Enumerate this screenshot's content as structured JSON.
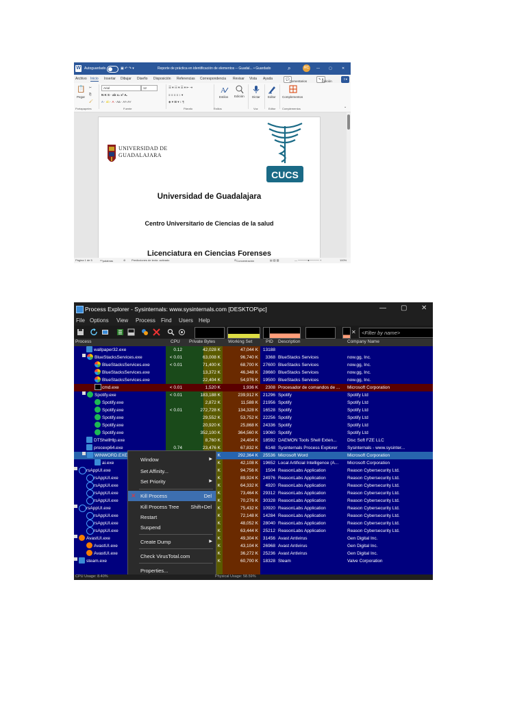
{
  "word": {
    "title": "Reporte de práctica en identificación de elementos -- Guadal... • Guardado",
    "autosave": "Autoguardado",
    "avatar": "RC",
    "menu": [
      "Archivo",
      "Inicio",
      "Insertar",
      "Dibujar",
      "Diseño",
      "Disposición",
      "Referencias",
      "Correspondencia",
      "Revisar",
      "Vista",
      "Ayuda"
    ],
    "comments_btn": "Comentarios",
    "editing_btn": "Edición",
    "font_name": "Arial",
    "font_size": "12",
    "ribbon": {
      "paste": "Pegar",
      "clipboard": "Portapapeles",
      "font_group": "Fuente",
      "paragraph": "Párrafo",
      "styles": "Estilos",
      "styles_group": "Estilos",
      "find": "Edición",
      "dictate": "Dictar",
      "voice": "Voz",
      "editor": "Editor",
      "editor_group": "Editor",
      "addins": "Complementos",
      "addins_group": "Complementos"
    },
    "doc": {
      "udg_logo_text_1": "Universidad de",
      "udg_logo_text_2": "Guadalajara",
      "cucs_label": "CUCS",
      "heading": "Universidad de Guadalajara",
      "subheading": "Centro Universitario de Ciencias de la salud",
      "partial_heading": "Licenciatura en Ciencias Forenses"
    },
    "status": {
      "page": "Página 1 de 5",
      "words": "palabras",
      "predictions": "Predicciones de texto: activado",
      "focus": "Concentración",
      "zoom": "100%"
    }
  },
  "procexp": {
    "title": "Process Explorer - Sysinternals: www.sysinternals.com [DESKTOP\\pc]",
    "menu": [
      "File",
      "Options",
      "View",
      "Process",
      "Find",
      "Users",
      "Help"
    ],
    "filter_placeholder": "<Filter by name>",
    "headers": {
      "process": "Process",
      "cpu": "CPU",
      "private": "Private Bytes",
      "working": "Working Set",
      "pid": "PID",
      "desc": "Description",
      "company": "Company Name"
    },
    "rows": [
      {
        "name": "wallpaper32.exe",
        "ind": 18,
        "icon": "sq",
        "cpu": "0.12",
        "pb": "42,028 K",
        "ws": "47,044 K",
        "pid": "13188",
        "desc": "",
        "co": ""
      },
      {
        "name": "BlueStacksServices.exe",
        "ind": 12,
        "icon": "bs",
        "tree": true,
        "cpu": "< 0.01",
        "pb": "63,008 K",
        "ws": "96,740 K",
        "pid": "3368",
        "desc": "BlueStacks Services",
        "co": "now.gg, Inc."
      },
      {
        "name": "BlueStacksServices.exe",
        "ind": 30,
        "icon": "bs",
        "cpu": "< 0.01",
        "pb": "71,400 K",
        "ws": "68,700 K",
        "pid": "27600",
        "desc": "BlueStacks Services",
        "co": "now.gg, Inc."
      },
      {
        "name": "BlueStacksServices.exe",
        "ind": 30,
        "icon": "bs",
        "cpu": "",
        "pb": "13,372 K",
        "ws": "46,348 K",
        "pid": "28660",
        "desc": "BlueStacks Services",
        "co": "now.gg, Inc."
      },
      {
        "name": "BlueStacksServices.exe",
        "ind": 30,
        "icon": "bs",
        "cpu": "",
        "pb": "22,404 K",
        "ws": "54,976 K",
        "pid": "19500",
        "desc": "BlueStacks Services",
        "co": "now.gg, Inc."
      },
      {
        "name": "cmd.exe",
        "ind": 30,
        "icon": "cm",
        "cpu": "< 0.01",
        "pb": "1,520 K",
        "ws": "1,936 K",
        "pid": "2308",
        "desc": "Procesador de comandos de ...",
        "co": "Microsoft Corporation",
        "cls": "cmd"
      },
      {
        "name": "Spotify.exe",
        "ind": 12,
        "icon": "sp",
        "tree": true,
        "cpu": "< 0.01",
        "pb": "183,188 K",
        "ws": "239,912 K",
        "pid": "21296",
        "desc": "Spotify",
        "co": "Spotify Ltd"
      },
      {
        "name": "Spotify.exe",
        "ind": 30,
        "icon": "sp",
        "cpu": "",
        "pb": "2,872 K",
        "ws": "11,588 K",
        "pid": "21956",
        "desc": "Spotify",
        "co": "Spotify Ltd"
      },
      {
        "name": "Spotify.exe",
        "ind": 30,
        "icon": "sp",
        "cpu": "< 0.01",
        "pb": "272,728 K",
        "ws": "134,328 K",
        "pid": "16528",
        "desc": "Spotify",
        "co": "Spotify Ltd"
      },
      {
        "name": "Spotify.exe",
        "ind": 30,
        "icon": "sp",
        "cpu": "",
        "pb": "29,552 K",
        "ws": "53,752 K",
        "pid": "22256",
        "desc": "Spotify",
        "co": "Spotify Ltd"
      },
      {
        "name": "Spotify.exe",
        "ind": 30,
        "icon": "sp",
        "cpu": "",
        "pb": "20,920 K",
        "ws": "25,868 K",
        "pid": "24336",
        "desc": "Spotify",
        "co": "Spotify Ltd"
      },
      {
        "name": "Spotify.exe",
        "ind": 30,
        "icon": "sp",
        "cpu": "",
        "pb": "352,100 K",
        "ws": "364,560 K",
        "pid": "19060",
        "desc": "Spotify",
        "co": "Spotify Ltd"
      },
      {
        "name": "DTShellHlp.exe",
        "ind": 18,
        "icon": "sq",
        "cpu": "",
        "pb": "8,760 K",
        "ws": "24,404 K",
        "pid": "18592",
        "desc": "DAEMON Tools Shell Exten...",
        "co": "Disc Soft FZE LLC"
      },
      {
        "name": "procexp64.exe",
        "ind": 18,
        "icon": "sq",
        "cpu": "0.74",
        "pb": "23,476 K",
        "ws": "67,832 K",
        "pid": "6148",
        "desc": "Sysinternals Process Explorer",
        "co": "Sysinternals - www.sysinter..."
      },
      {
        "name": "WINWORD.EXE",
        "ind": 12,
        "icon": "sq",
        "tree": true,
        "cpu": "",
        "pb": "K",
        "ws": "292,364 K",
        "pid": "25536",
        "desc": "Microsoft Word",
        "co": "Microsoft Corporation",
        "cls": "sel"
      },
      {
        "name": "ai.exe",
        "ind": 30,
        "icon": "sq",
        "cpu": "",
        "pb": "K",
        "ws": "42,108 K",
        "pid": "19652",
        "desc": "Local Artificial Intelligence (A...",
        "co": "Microsoft Corporation"
      },
      {
        "name": "rsAppUI.exe",
        "ind": 0,
        "icon": "rs",
        "tree": true,
        "cpu": "",
        "pb": "K",
        "ws": "94,756 K",
        "pid": "1504",
        "desc": "ReasonLabs Application",
        "co": "Reason Cybersecurity Ltd."
      },
      {
        "name": "rsAppUI.exe",
        "ind": 18,
        "icon": "rs",
        "cpu": "",
        "pb": "K",
        "ws": "89,924 K",
        "pid": "24976",
        "desc": "ReasonLabs Application",
        "co": "Reason Cybersecurity Ltd."
      },
      {
        "name": "rsAppUI.exe",
        "ind": 18,
        "icon": "rs",
        "cpu": "",
        "pb": "K",
        "ws": "64,332 K",
        "pid": "4920",
        "desc": "ReasonLabs Application",
        "co": "Reason Cybersecurity Ltd."
      },
      {
        "name": "rsAppUI.exe",
        "ind": 18,
        "icon": "rs",
        "cpu": "",
        "pb": "K",
        "ws": "73,464 K",
        "pid": "29312",
        "desc": "ReasonLabs Application",
        "co": "Reason Cybersecurity Ltd."
      },
      {
        "name": "rsAppUI.exe",
        "ind": 18,
        "icon": "rs",
        "cpu": "",
        "pb": "K",
        "ws": "70,276 K",
        "pid": "30328",
        "desc": "ReasonLabs Application",
        "co": "Reason Cybersecurity Ltd."
      },
      {
        "name": "rsAppUI.exe",
        "ind": 0,
        "icon": "rs",
        "tree": true,
        "cpu": "",
        "pb": "K",
        "ws": "75,432 K",
        "pid": "10920",
        "desc": "ReasonLabs Application",
        "co": "Reason Cybersecurity Ltd."
      },
      {
        "name": "rsAppUI.exe",
        "ind": 18,
        "icon": "rs",
        "cpu": "",
        "pb": "K",
        "ws": "72,148 K",
        "pid": "14284",
        "desc": "ReasonLabs Application",
        "co": "Reason Cybersecurity Ltd."
      },
      {
        "name": "rsAppUI.exe",
        "ind": 18,
        "icon": "rs",
        "cpu": "",
        "pb": "K",
        "ws": "48,052 K",
        "pid": "28040",
        "desc": "ReasonLabs Application",
        "co": "Reason Cybersecurity Ltd."
      },
      {
        "name": "rsAppUI.exe",
        "ind": 18,
        "icon": "rs",
        "cpu": "",
        "pb": "K",
        "ws": "63,444 K",
        "pid": "25212",
        "desc": "ReasonLabs Application",
        "co": "Reason Cybersecurity Ltd."
      },
      {
        "name": "AvastUI.exe",
        "ind": 0,
        "icon": "av",
        "tree": true,
        "cpu": "",
        "pb": "K",
        "ws": "49,304 K",
        "pid": "31456",
        "desc": "Avast Antivirus",
        "co": "Gen Digital Inc."
      },
      {
        "name": "AvastUI.exe",
        "ind": 18,
        "icon": "av",
        "cpu": "",
        "pb": "K",
        "ws": "43,104 K",
        "pid": "26968",
        "desc": "Avast Antivirus",
        "co": "Gen Digital Inc."
      },
      {
        "name": "AvastUI.exe",
        "ind": 18,
        "icon": "av",
        "cpu": "",
        "pb": "K",
        "ws": "36,272 K",
        "pid": "25236",
        "desc": "Avast Antivirus",
        "co": "Gen Digital Inc."
      },
      {
        "name": "steam.exe",
        "ind": 0,
        "icon": "sq",
        "tree": true,
        "cpu": "",
        "pb": "K",
        "ws": "60,700 K",
        "pid": "18328",
        "desc": "Steam",
        "co": "Valve Corporation"
      }
    ],
    "context_menu": [
      {
        "label": "Window",
        "arrow": true
      },
      {
        "label": "Set Affinity..."
      },
      {
        "label": "Set Priority",
        "arrow": true
      },
      {
        "label": "Kill Process",
        "shortcut": "Del",
        "hl": true
      },
      {
        "label": "Kill Process Tree",
        "shortcut": "Shift+Del"
      },
      {
        "label": "Restart"
      },
      {
        "label": "Suspend"
      },
      {
        "label": "Create Dump",
        "arrow": true
      },
      {
        "label": "Check VirusTotal.com"
      },
      {
        "label": "Properties..."
      }
    ],
    "status": {
      "cpu": "CPU Usage: 8.40%",
      "physical": "Physical Usage: 58.59%"
    },
    "colors": {
      "bg": "#00007e",
      "cpu_col": "#1a4a1a",
      "private_col": "#5a5a00",
      "working_col": "#6a2a00",
      "selection": "#2764ae"
    }
  }
}
